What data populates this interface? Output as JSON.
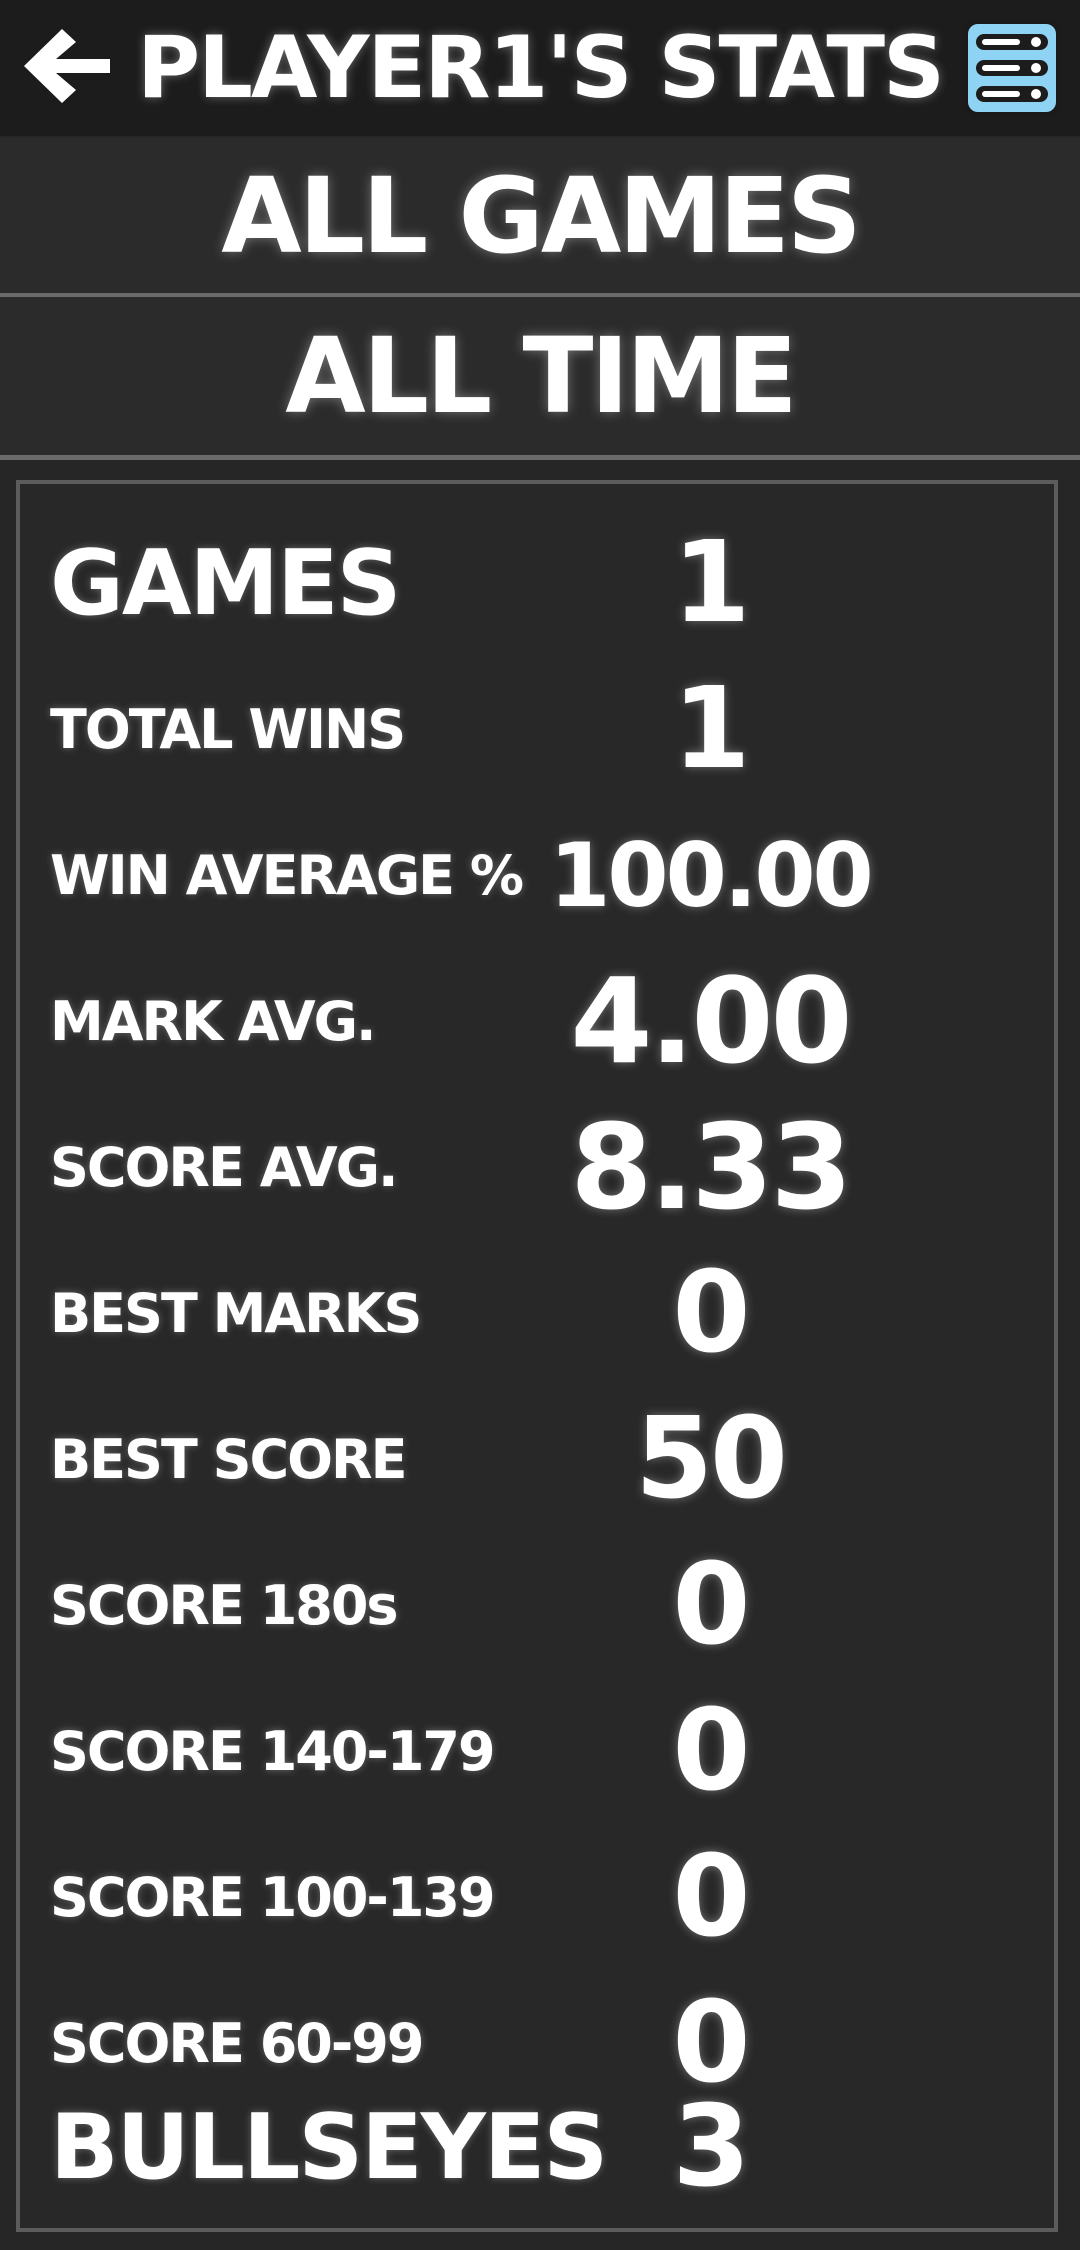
{
  "header": {
    "title": "PLAYER1'S STATS",
    "back_icon": "arrow-left-icon",
    "menu_icon": "list-menu-icon",
    "menu_icon_color": "#8fd3f4"
  },
  "filters": {
    "games": "ALL GAMES",
    "period": "ALL TIME"
  },
  "stats": [
    {
      "label": "GAMES",
      "value": "1"
    },
    {
      "label": "TOTAL WINS",
      "value": "1"
    },
    {
      "label": "WIN AVERAGE %",
      "value": "100.00"
    },
    {
      "label": "MARK AVG.",
      "value": "4.00"
    },
    {
      "label": "SCORE AVG.",
      "value": "8.33"
    },
    {
      "label": "BEST MARKS",
      "value": "0"
    },
    {
      "label": "BEST SCORE",
      "value": "50"
    },
    {
      "label": "SCORE 180s",
      "value": "0"
    },
    {
      "label": "SCORE 140-179",
      "value": "0"
    },
    {
      "label": "SCORE 100-139",
      "value": "0"
    },
    {
      "label": "SCORE 60-99",
      "value": "0"
    },
    {
      "label": "BULLSEYES",
      "value": "3"
    }
  ]
}
